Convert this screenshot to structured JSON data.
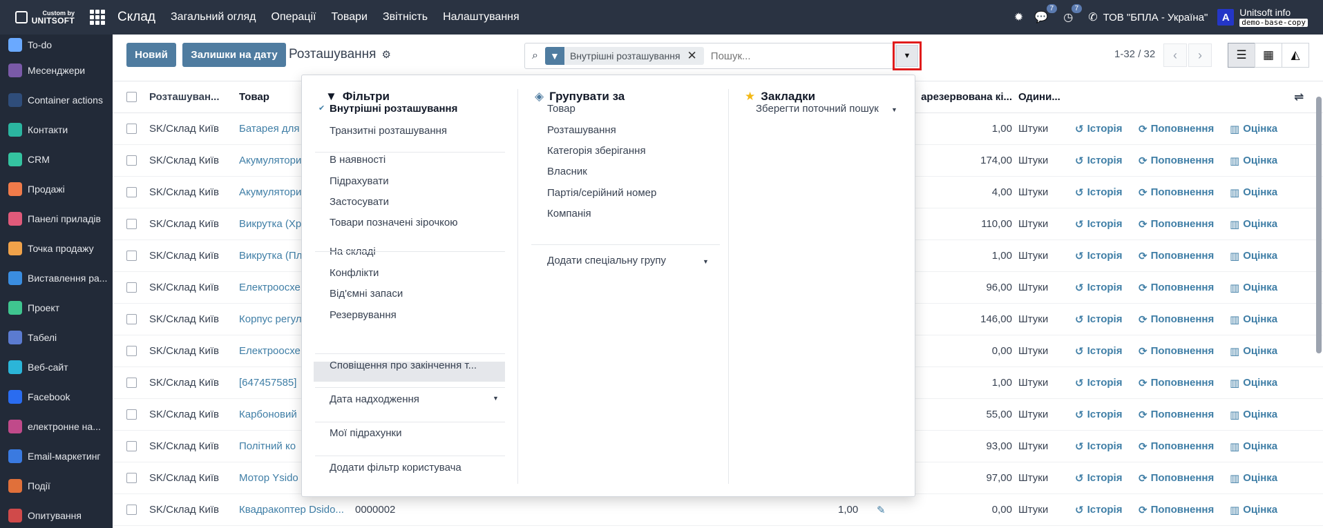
{
  "topbar": {
    "logo_small": "Custom by",
    "logo_big": "UNITSOFT",
    "app_title": "Склад",
    "menu": [
      "Загальний огляд",
      "Операції",
      "Товари",
      "Звітність",
      "Налаштування"
    ],
    "chat_count": "7",
    "activity_count": "7",
    "company": "ТОВ \"БПЛА - Україна\"",
    "avatar_letter": "A",
    "user_name": "Unitsoft info",
    "database": "demo-base-copy"
  },
  "sidebar": {
    "items": [
      {
        "label": "To-do",
        "icon": "todo-icon",
        "color": "#6aa9ff"
      },
      {
        "label": "Месенджери",
        "icon": "messenger-icon",
        "color": "#7a5aa8"
      },
      {
        "label": "Container actions",
        "icon": "container-icon",
        "color": "#2f4d7a"
      },
      {
        "label": "Контакти",
        "icon": "contacts-icon",
        "color": "#2bb5a0"
      },
      {
        "label": "CRM",
        "icon": "crm-icon",
        "color": "#34c3a0"
      },
      {
        "label": "Продажі",
        "icon": "sales-icon",
        "color": "#f07b4a"
      },
      {
        "label": "Панелі приладів",
        "icon": "dashboard-icon",
        "color": "#e05a7a"
      },
      {
        "label": "Точка продажу",
        "icon": "pos-icon",
        "color": "#f0a24a"
      },
      {
        "label": "Виставлення ра...",
        "icon": "invoicing-icon",
        "color": "#3a8de0"
      },
      {
        "label": "Проект",
        "icon": "project-icon",
        "color": "#3fc58f"
      },
      {
        "label": "Табелі",
        "icon": "timesheet-icon",
        "color": "#5b7bd0"
      },
      {
        "label": "Веб-сайт",
        "icon": "website-icon",
        "color": "#2bb5d8"
      },
      {
        "label": "Facebook",
        "icon": "facebook-icon",
        "color": "#2a6cf0"
      },
      {
        "label": "електронне на...",
        "icon": "elearning-icon",
        "color": "#c04a8a"
      },
      {
        "label": "Email-маркетинг",
        "icon": "email-marketing-icon",
        "color": "#3a7ae0"
      },
      {
        "label": "Події",
        "icon": "events-icon",
        "color": "#e0703a"
      },
      {
        "label": "Опитування",
        "icon": "survey-icon",
        "color": "#d04a4a"
      }
    ]
  },
  "control": {
    "new_button": "Новий",
    "stock_date_button": "Залишки на дату",
    "breadcrumb": "Розташування",
    "facet_label": "Внутрішні розташування",
    "search_placeholder": "Пошук...",
    "pager": "1-32 / 32"
  },
  "table": {
    "headers": {
      "location": "Розташуван...",
      "product": "Товар",
      "reserved": "арезервована кі...",
      "uom": "Одини..."
    },
    "actions": {
      "history": "Історія",
      "replenish": "Поповнення",
      "valuation": "Оцінка"
    },
    "rows": [
      {
        "location": "SK/Склад Київ",
        "product": "Батарея для",
        "lot": "",
        "qty": "",
        "reserved": "1,00",
        "uom": "Штуки"
      },
      {
        "location": "SK/Склад Київ",
        "product": "Акумулятори",
        "lot": "",
        "qty": "",
        "reserved": "174,00",
        "uom": "Штуки"
      },
      {
        "location": "SK/Склад Київ",
        "product": "Акумулятори",
        "lot": "",
        "qty": "",
        "reserved": "4,00",
        "uom": "Штуки"
      },
      {
        "location": "SK/Склад Київ",
        "product": "Викрутка (Хр",
        "lot": "",
        "qty": "",
        "reserved": "110,00",
        "uom": "Штуки"
      },
      {
        "location": "SK/Склад Київ",
        "product": "Викрутка (Пл",
        "lot": "",
        "qty": "",
        "reserved": "1,00",
        "uom": "Штуки"
      },
      {
        "location": "SK/Склад Київ",
        "product": "Електроосхе",
        "lot": "",
        "qty": "",
        "reserved": "96,00",
        "uom": "Штуки"
      },
      {
        "location": "SK/Склад Київ",
        "product": "Корпус регул",
        "lot": "",
        "qty": "",
        "reserved": "146,00",
        "uom": "Штуки"
      },
      {
        "location": "SK/Склад Київ",
        "product": "Електроосхе",
        "lot": "",
        "qty": "",
        "reserved": "0,00",
        "uom": "Штуки"
      },
      {
        "location": "SK/Склад Київ",
        "product": "[647457585]",
        "lot": "",
        "qty": "",
        "reserved": "1,00",
        "uom": "Штуки"
      },
      {
        "location": "SK/Склад Київ",
        "product": "Карбоновий",
        "lot": "",
        "qty": "",
        "reserved": "55,00",
        "uom": "Штуки"
      },
      {
        "location": "SK/Склад Київ",
        "product": "Політний ко",
        "lot": "",
        "qty": "",
        "reserved": "93,00",
        "uom": "Штуки"
      },
      {
        "location": "SK/Склад Київ",
        "product": "Мотор Ysido",
        "lot": "",
        "qty": "",
        "reserved": "97,00",
        "uom": "Штуки"
      },
      {
        "location": "SK/Склад Київ",
        "product": "Квадракоптер Dsido...",
        "lot": "0000002",
        "qty": "1,00",
        "reserved": "0,00",
        "uom": "Штуки"
      }
    ]
  },
  "dropdown": {
    "filters_title": "Фільтри",
    "filters": [
      {
        "label": "Внутрішні розташування",
        "checked": true
      },
      {
        "label": "Транзитні розташування"
      },
      {
        "label": "В наявності"
      },
      {
        "label": "Підрахувати"
      },
      {
        "label": "Застосувати"
      },
      {
        "label": "Товари позначені зірочкою"
      },
      {
        "label": "На складі"
      },
      {
        "label": "Конфлікти"
      },
      {
        "label": "Від'ємні запаси"
      },
      {
        "label": "Резервування"
      },
      {
        "label": "Сповіщення про закінчення т..."
      },
      {
        "label": "Дата надходження"
      },
      {
        "label": "Мої підрахунки"
      },
      {
        "label": "Додати фільтр користувача"
      }
    ],
    "groupby_title": "Групувати за",
    "groupby": [
      "Товар",
      "Розташування",
      "Категорія зберігання",
      "Власник",
      "Партія/серійний номер",
      "Компанія"
    ],
    "add_custom_group": "Додати спеціальну групу",
    "favorites_title": "Закладки",
    "save_search": "Зберегти поточний пошук"
  }
}
